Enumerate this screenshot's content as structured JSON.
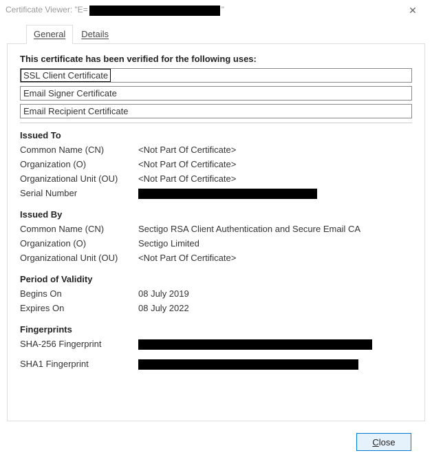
{
  "window": {
    "title_prefix": "Certificate Viewer: \"E=",
    "title_suffix": "\""
  },
  "tabs": {
    "general": "General",
    "details": "Details"
  },
  "verified_heading": "This certificate has been verified for the following uses:",
  "uses": {
    "ssl_client": "SSL Client Certificate",
    "email_signer": "Email Signer Certificate",
    "email_recipient": "Email Recipient Certificate"
  },
  "issued_to": {
    "heading": "Issued To",
    "cn_label": "Common Name (CN)",
    "cn_value": "<Not Part Of Certificate>",
    "o_label": "Organization (O)",
    "o_value": "<Not Part Of Certificate>",
    "ou_label": "Organizational Unit (OU)",
    "ou_value": "<Not Part Of Certificate>",
    "serial_label": "Serial Number"
  },
  "issued_by": {
    "heading": "Issued By",
    "cn_label": "Common Name (CN)",
    "cn_value": "Sectigo RSA Client Authentication and Secure Email CA",
    "o_label": "Organization (O)",
    "o_value": "Sectigo Limited",
    "ou_label": "Organizational Unit (OU)",
    "ou_value": "<Not Part Of Certificate>"
  },
  "validity": {
    "heading": "Period of Validity",
    "begins_label": "Begins On",
    "begins_value": "08 July 2019",
    "expires_label": "Expires On",
    "expires_value": "08 July 2022"
  },
  "fingerprints": {
    "heading": "Fingerprints",
    "sha256_label": "SHA-256 Fingerprint",
    "sha1_label": "SHA1 Fingerprint"
  },
  "footer": {
    "close_prefix": "C",
    "close_rest": "lose"
  }
}
